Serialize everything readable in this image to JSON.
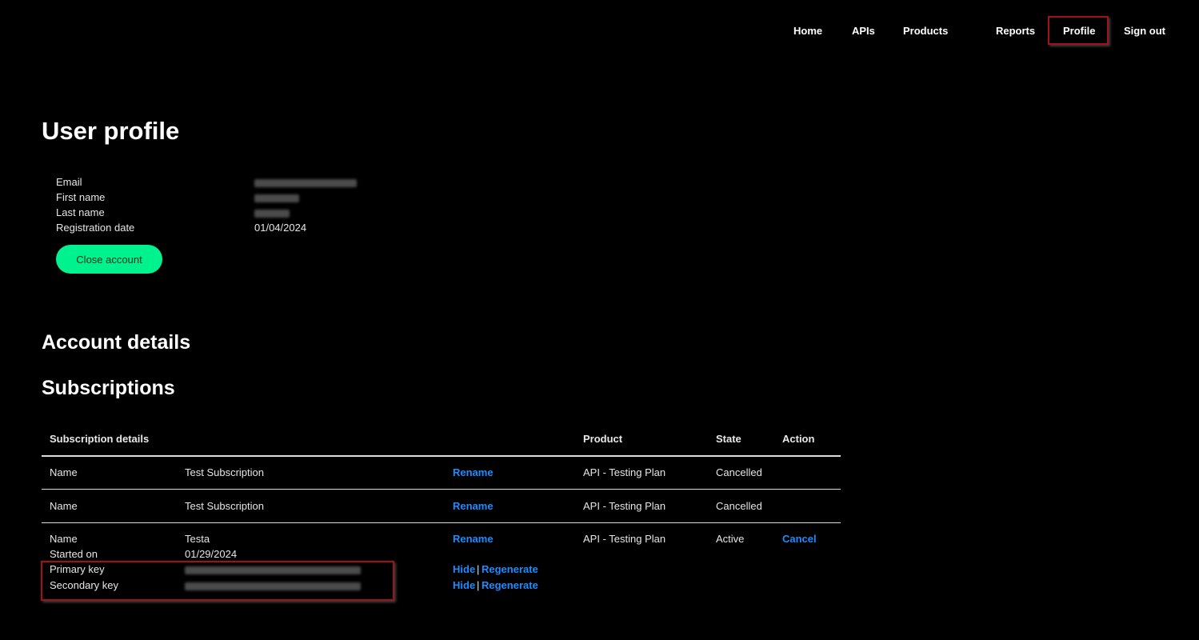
{
  "nav": {
    "home": "Home",
    "apis": "APIs",
    "products": "Products",
    "reports": "Reports",
    "profile": "Profile",
    "signout": "Sign out"
  },
  "profile": {
    "title": "User profile",
    "email_label": "Email",
    "first_name_label": "First name",
    "last_name_label": "Last name",
    "registration_label": "Registration date",
    "registration_value": "01/04/2024",
    "close_account": "Close account"
  },
  "account_details_title": "Account details",
  "subscriptions": {
    "title": "Subscriptions",
    "headers": {
      "details": "Subscription details",
      "product": "Product",
      "state": "State",
      "action": "Action"
    },
    "rows": [
      {
        "name_label": "Name",
        "name": "Test Subscription",
        "rename": "Rename",
        "product": "API - Testing Plan",
        "state": "Cancelled"
      },
      {
        "name_label": "Name",
        "name": "Test Subscription",
        "rename": "Rename",
        "product": "API - Testing Plan",
        "state": "Cancelled"
      },
      {
        "name_label": "Name",
        "name": "Testa",
        "rename": "Rename",
        "product": "API - Testing Plan",
        "state": "Active",
        "action": "Cancel",
        "started_label": "Started on",
        "started_value": "01/29/2024",
        "primary_key_label": "Primary key",
        "secondary_key_label": "Secondary key",
        "hide": "Hide",
        "separator": "|",
        "regenerate": "Regenerate"
      }
    ]
  }
}
